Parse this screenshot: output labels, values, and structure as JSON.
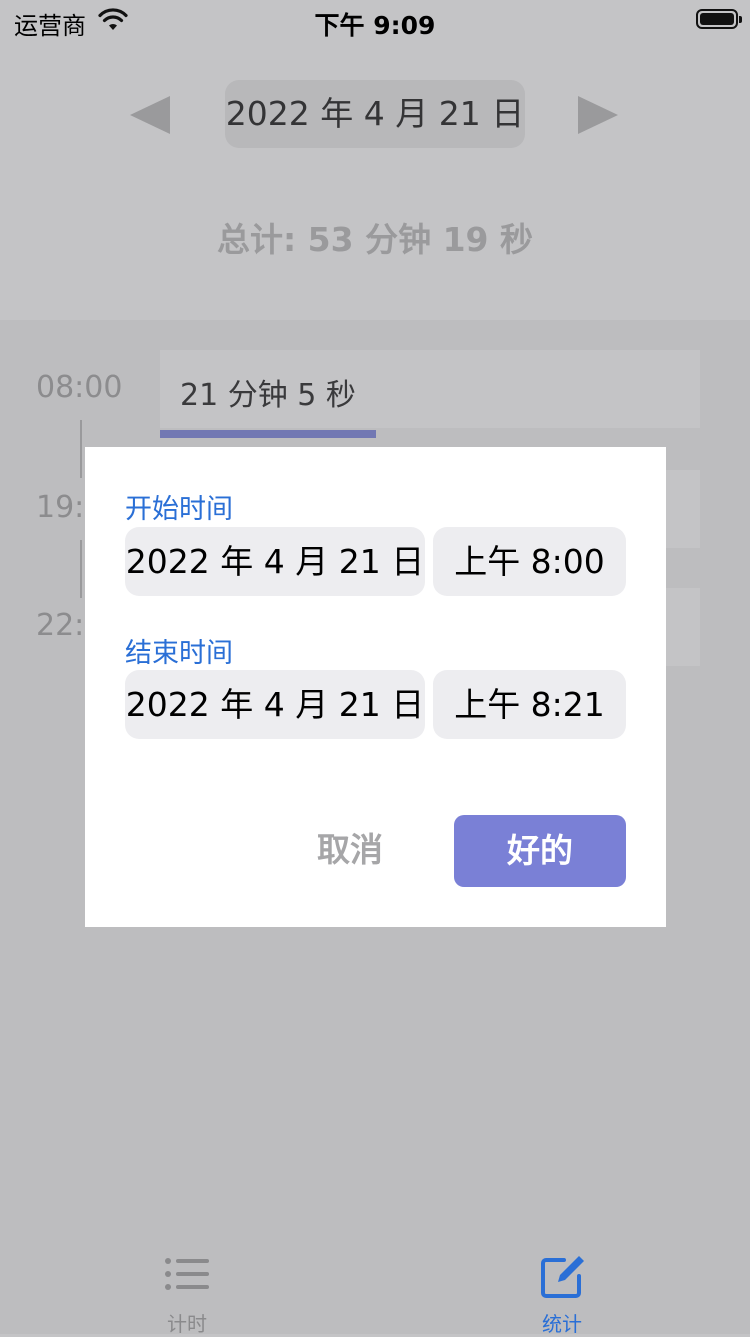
{
  "status_bar": {
    "carrier": "运营商",
    "time": "下午 9:09"
  },
  "header": {
    "date": "2022 年 4 月 21 日",
    "total": "总计: 53 分钟 19 秒"
  },
  "timeline": {
    "entries": [
      {
        "time": "08:00",
        "duration": "21 分钟 5 秒",
        "progress": 0.4
      },
      {
        "time": "19:",
        "duration": ""
      },
      {
        "time": "22:",
        "duration": ""
      }
    ]
  },
  "dialog": {
    "start_label": "开始时间",
    "start_date": "2022 年 4 月 21 日",
    "start_time": "上午 8:00",
    "end_label": "结束时间",
    "end_date": "2022 年 4 月 21 日",
    "end_time": "上午 8:21",
    "cancel": "取消",
    "ok": "好的"
  },
  "tabs": [
    {
      "label": "计时",
      "icon": "list-icon",
      "active": false
    },
    {
      "label": "统计",
      "icon": "edit-icon",
      "active": true
    }
  ],
  "colors": {
    "accent": "#7a80d6",
    "link_blue": "#2a6fd6",
    "progress": "#7278b3"
  }
}
